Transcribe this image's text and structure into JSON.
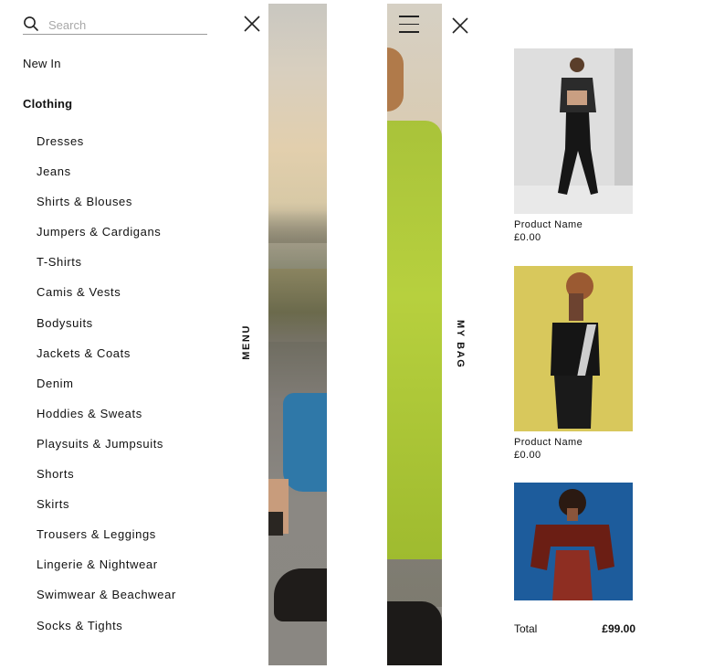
{
  "menu": {
    "search": {
      "placeholder": "Search"
    },
    "new_in": "New In",
    "clothing": "Clothing",
    "items": [
      "Dresses",
      "Jeans",
      "Shirts & Blouses",
      "Jumpers & Cardigans",
      "T-Shirts",
      "Camis & Vests",
      "Bodysuits",
      "Jackets & Coats",
      "Denim",
      "Hoddies & Sweats",
      "Playsuits & Jumpsuits",
      "Shorts",
      "Skirts",
      "Trousers & Leggings",
      "Lingerie & Nightwear",
      "Swimwear & Beachwear",
      "Socks & Tights"
    ],
    "side_label": "MENU"
  },
  "bag": {
    "side_label": "MY BAG",
    "products": [
      {
        "name": "Product Name",
        "price": "£0.00"
      },
      {
        "name": "Product Name",
        "price": "£0.00"
      }
    ],
    "total_label": "Total",
    "total_value": "£99.00"
  },
  "icons": {
    "search": "search-icon",
    "close": "close-icon",
    "bag": "shopping-bag-icon",
    "menu": "hamburger-icon"
  }
}
